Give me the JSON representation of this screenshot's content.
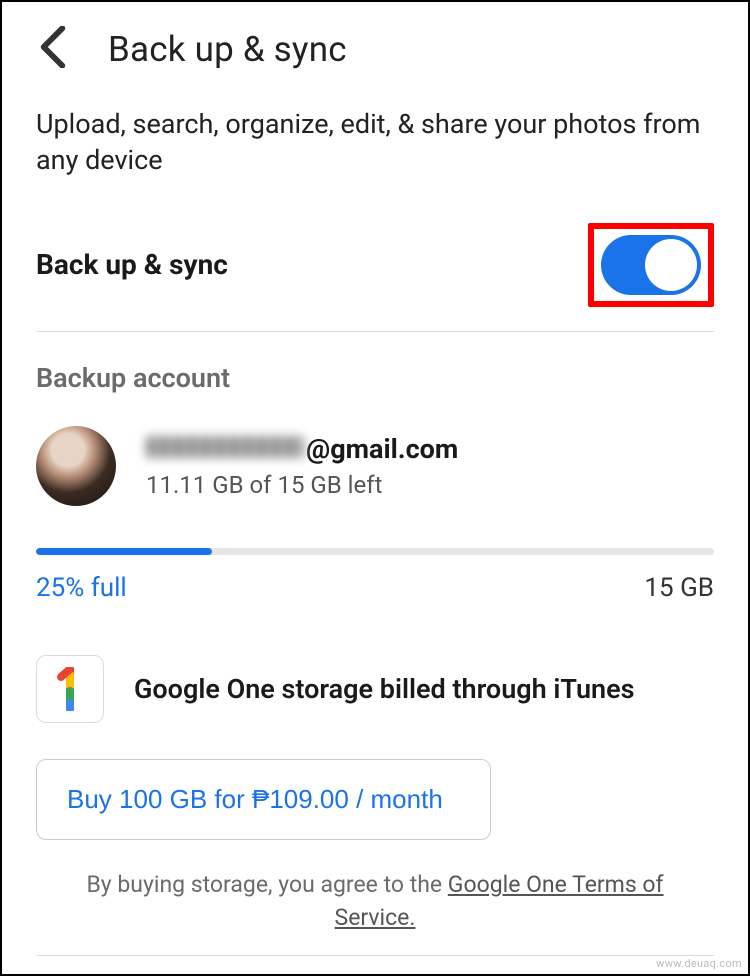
{
  "header": {
    "title": "Back up & sync"
  },
  "description": "Upload, search, organize, edit, & share your photos from any device",
  "toggle": {
    "label": "Back up & sync",
    "on": true
  },
  "backup_account": {
    "section_label": "Backup account",
    "email_domain": "@gmail.com",
    "storage_left": "11.11 GB of 15 GB left"
  },
  "storage": {
    "percent_label": "25% full",
    "percent_value": 25,
    "total_label": "15 GB"
  },
  "google_one": {
    "billing_text": "Google One storage billed through iTunes",
    "buy_label": "Buy 100 GB for ₱109.00 / month"
  },
  "disclaimer": {
    "prefix": "By buying storage, you agree to the ",
    "link": "Google One Terms of Service."
  },
  "watermark": "www.deuaq.com"
}
